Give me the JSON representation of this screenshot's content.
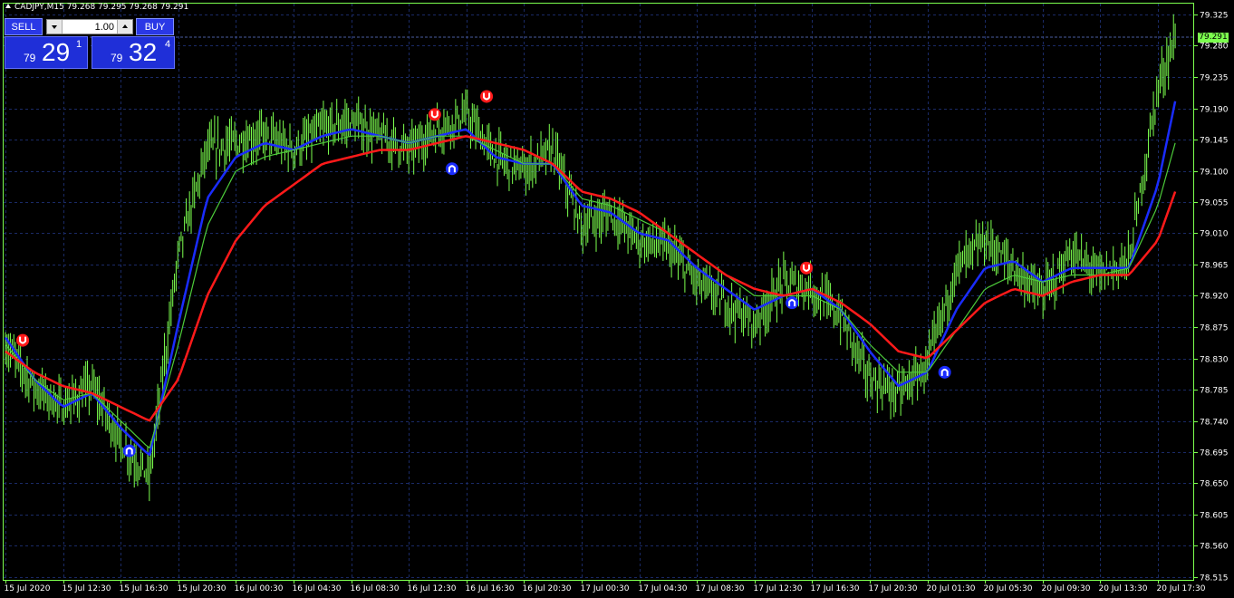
{
  "symbol_info": "CADJPY,M15  79.268 79.295 79.268 79.291",
  "trade_panel": {
    "sell_label": "SELL",
    "buy_label": "BUY",
    "lot_value": "1.00",
    "bid": {
      "prefix": "79",
      "big": "29",
      "super": "1"
    },
    "ask": {
      "prefix": "79",
      "big": "32",
      "super": "4"
    }
  },
  "current_price_label": "79.291",
  "colors": {
    "background": "#000000",
    "axis": "#7cff4e",
    "grid": "#1a2a66",
    "candles": "#7cff4e",
    "ma_fast": "#1a2cff",
    "ma_mid": "#4dcc3a",
    "ma_slow": "#ff1a1a",
    "signal_buy": "#1a2cff",
    "signal_sell": "#ff1a1a"
  },
  "chart_data": {
    "type": "line",
    "symbol": "CADJPY",
    "timeframe": "M15",
    "y_ticks": [
      "79.325",
      "79.280",
      "79.235",
      "79.190",
      "79.145",
      "79.100",
      "79.055",
      "79.010",
      "78.965",
      "78.920",
      "78.875",
      "78.830",
      "78.785",
      "78.740",
      "78.695",
      "78.650",
      "78.605",
      "78.560",
      "78.515"
    ],
    "ylim": [
      78.51,
      79.34
    ],
    "x_ticks": [
      "15 Jul 2020",
      "15 Jul 12:30",
      "15 Jul 16:30",
      "15 Jul 20:30",
      "16 Jul 00:30",
      "16 Jul 04:30",
      "16 Jul 08:30",
      "16 Jul 12:30",
      "16 Jul 16:30",
      "16 Jul 20:30",
      "17 Jul 00:30",
      "17 Jul 04:30",
      "17 Jul 08:30",
      "17 Jul 12:30",
      "17 Jul 16:30",
      "17 Jul 20:30",
      "20 Jul 01:30",
      "20 Jul 05:30",
      "20 Jul 09:30",
      "20 Jul 13:30",
      "20 Jul 17:30"
    ],
    "grid": true,
    "price_series": {
      "name": "price",
      "x": [
        0,
        0.5,
        1,
        1.5,
        2,
        2.5,
        3,
        3.5,
        4,
        4.5,
        5,
        5.5,
        6,
        6.5,
        7,
        7.5,
        8,
        8.5,
        9,
        9.5,
        10,
        10.5,
        11,
        11.5,
        12,
        12.5,
        13,
        13.5,
        14,
        14.5,
        15,
        15.5,
        16,
        16.5,
        17,
        17.5,
        18,
        18.5,
        19,
        19.5,
        20,
        20.3
      ],
      "values": [
        78.85,
        78.79,
        78.76,
        78.79,
        78.71,
        78.66,
        78.98,
        79.13,
        79.14,
        79.15,
        79.13,
        79.16,
        79.17,
        79.15,
        79.13,
        79.16,
        79.18,
        79.12,
        79.1,
        79.13,
        79.02,
        79.04,
        79.0,
        78.99,
        78.94,
        78.91,
        78.88,
        78.94,
        78.93,
        78.89,
        78.8,
        78.78,
        78.82,
        78.96,
        79.0,
        78.96,
        78.92,
        78.98,
        78.95,
        78.97,
        79.22,
        79.291
      ]
    },
    "series": [
      {
        "name": "MA fast",
        "color": "#1a2cff",
        "x": [
          0,
          0.5,
          1,
          1.5,
          2,
          2.5,
          3,
          3.5,
          4,
          4.5,
          5,
          5.5,
          6,
          6.5,
          7,
          7.5,
          8,
          8.5,
          9,
          9.5,
          10,
          10.5,
          11,
          11.5,
          12,
          12.5,
          13,
          13.5,
          14,
          14.5,
          15,
          15.5,
          16,
          16.5,
          17,
          17.5,
          18,
          18.5,
          19,
          19.5,
          20,
          20.3
        ],
        "values": [
          78.86,
          78.8,
          78.76,
          78.78,
          78.73,
          78.69,
          78.88,
          79.06,
          79.12,
          79.14,
          79.13,
          79.15,
          79.16,
          79.15,
          79.14,
          79.15,
          79.16,
          79.12,
          79.11,
          79.11,
          79.05,
          79.04,
          79.01,
          79.0,
          78.96,
          78.93,
          78.9,
          78.92,
          78.93,
          78.9,
          78.84,
          78.79,
          78.81,
          78.9,
          78.96,
          78.97,
          78.94,
          78.96,
          78.96,
          78.96,
          79.08,
          79.2
        ]
      },
      {
        "name": "MA mid",
        "color": "#4dcc3a",
        "x": [
          0,
          0.5,
          1,
          1.5,
          2,
          2.5,
          3,
          3.5,
          4,
          4.5,
          5,
          5.5,
          6,
          6.5,
          7,
          7.5,
          8,
          8.5,
          9,
          9.5,
          10,
          10.5,
          11,
          11.5,
          12,
          12.5,
          13,
          13.5,
          14,
          14.5,
          15,
          15.5,
          16,
          16.5,
          17,
          17.5,
          18,
          18.5,
          19,
          19.5,
          20,
          20.3
        ],
        "values": [
          78.85,
          78.8,
          78.77,
          78.78,
          78.74,
          78.7,
          78.85,
          79.02,
          79.1,
          79.12,
          79.13,
          79.14,
          79.15,
          79.15,
          79.14,
          79.15,
          79.15,
          79.13,
          79.11,
          79.11,
          79.06,
          79.05,
          79.03,
          79.01,
          78.98,
          78.95,
          78.92,
          78.92,
          78.92,
          78.9,
          78.85,
          78.81,
          78.81,
          78.87,
          78.93,
          78.95,
          78.94,
          78.95,
          78.95,
          78.96,
          79.05,
          79.14
        ]
      },
      {
        "name": "MA slow",
        "color": "#ff1a1a",
        "x": [
          0,
          0.5,
          1,
          1.5,
          2,
          2.5,
          3,
          3.5,
          4,
          4.5,
          5,
          5.5,
          6,
          6.5,
          7,
          7.5,
          8,
          8.5,
          9,
          9.5,
          10,
          10.5,
          11,
          11.5,
          12,
          12.5,
          13,
          13.5,
          14,
          14.5,
          15,
          15.5,
          16,
          16.5,
          17,
          17.5,
          18,
          18.5,
          19,
          19.5,
          20,
          20.3
        ],
        "values": [
          78.84,
          78.81,
          78.79,
          78.78,
          78.76,
          78.74,
          78.8,
          78.92,
          79.0,
          79.05,
          79.08,
          79.11,
          79.12,
          79.13,
          79.13,
          79.14,
          79.15,
          79.14,
          79.13,
          79.11,
          79.07,
          79.06,
          79.04,
          79.01,
          78.98,
          78.95,
          78.93,
          78.92,
          78.93,
          78.91,
          78.88,
          78.84,
          78.83,
          78.87,
          78.91,
          78.93,
          78.92,
          78.94,
          78.95,
          78.95,
          79.0,
          79.07
        ]
      }
    ],
    "signals": [
      {
        "type": "sell",
        "x": 0.3,
        "y": 78.856
      },
      {
        "type": "buy",
        "x": 2.15,
        "y": 78.697
      },
      {
        "type": "sell",
        "x": 7.45,
        "y": 79.181
      },
      {
        "type": "buy",
        "x": 7.75,
        "y": 79.103
      },
      {
        "type": "sell",
        "x": 8.35,
        "y": 79.207
      },
      {
        "type": "sell",
        "x": 13.9,
        "y": 78.96
      },
      {
        "type": "buy",
        "x": 13.65,
        "y": 78.91
      },
      {
        "type": "buy",
        "x": 16.3,
        "y": 78.81
      }
    ]
  }
}
